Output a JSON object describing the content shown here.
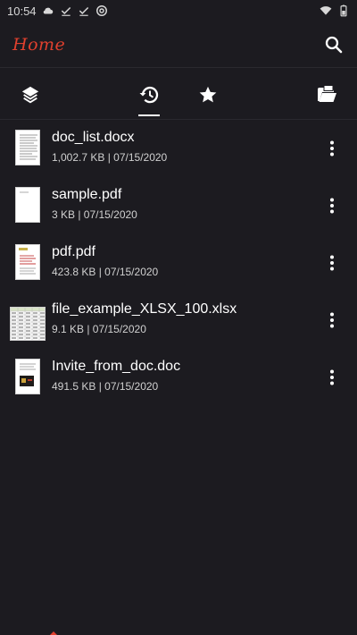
{
  "status_bar": {
    "time": "10:54",
    "icons": [
      "cloud-icon",
      "check-icon",
      "check-icon",
      "at-icon",
      "wifi-icon",
      "battery-icon"
    ]
  },
  "app_bar": {
    "title": "Home",
    "search_icon": "search-icon"
  },
  "tabs": [
    {
      "name": "layers",
      "icon": "layers-icon",
      "selected": false
    },
    {
      "name": "recent",
      "icon": "history-icon",
      "selected": true
    },
    {
      "name": "favorites",
      "icon": "star-icon",
      "selected": false
    },
    {
      "name": "browse",
      "icon": "folder-open-icon",
      "selected": false
    }
  ],
  "files": [
    {
      "name": "doc_list.docx",
      "meta": "1,002.7 KB | 07/15/2020",
      "thumb": "doc"
    },
    {
      "name": "sample.pdf",
      "meta": "3 KB | 07/15/2020",
      "thumb": "pdf-plain"
    },
    {
      "name": "pdf.pdf",
      "meta": "423.8 KB | 07/15/2020",
      "thumb": "pdf-red"
    },
    {
      "name": "file_example_XLSX_100.xlsx",
      "meta": "9.1 KB | 07/15/2020",
      "thumb": "xlsx"
    },
    {
      "name": "Invite_from_doc.doc",
      "meta": "491.5 KB | 07/15/2020",
      "thumb": "invite"
    }
  ],
  "colors": {
    "background": "#1c1b20",
    "accent": "#e0402e",
    "text": "#ffffff",
    "subtext": "#d0d0d0"
  }
}
